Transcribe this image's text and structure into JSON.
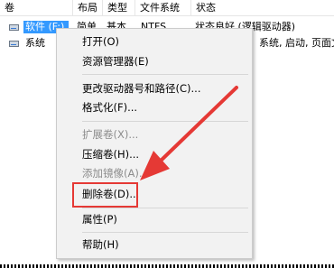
{
  "columns": [
    "卷",
    "布局",
    "类型",
    "文件系统",
    "状态"
  ],
  "volumes": [
    {
      "name": "软件 (F:)",
      "layout": "简单",
      "type": "基本",
      "fs": "NTFS",
      "status": "状态良好 (逻辑驱动器)",
      "selected": true
    },
    {
      "name": "系统",
      "layout": "",
      "type": "",
      "fs": "",
      "status": "系统, 启动, 页面文",
      "selected": false
    }
  ],
  "context_menu": {
    "items": [
      {
        "label": "打开(O)",
        "disabled": false
      },
      {
        "label": "资源管理器(E)",
        "disabled": false
      },
      {
        "label": "更改驱动器号和路径(C)...",
        "disabled": false
      },
      {
        "label": "格式化(F)...",
        "disabled": false
      },
      {
        "label": "扩展卷(X)...",
        "disabled": true
      },
      {
        "label": "压缩卷(H)...",
        "disabled": false
      },
      {
        "label": "添加镜像(A)...",
        "disabled": true
      },
      {
        "label": "删除卷(D)...",
        "disabled": false,
        "highlighted": true
      },
      {
        "label": "属性(P)",
        "disabled": false
      },
      {
        "label": "帮助(H)",
        "disabled": false
      }
    ]
  },
  "colors": {
    "selection": "#3399ff",
    "annotation_red": "#e53935"
  }
}
